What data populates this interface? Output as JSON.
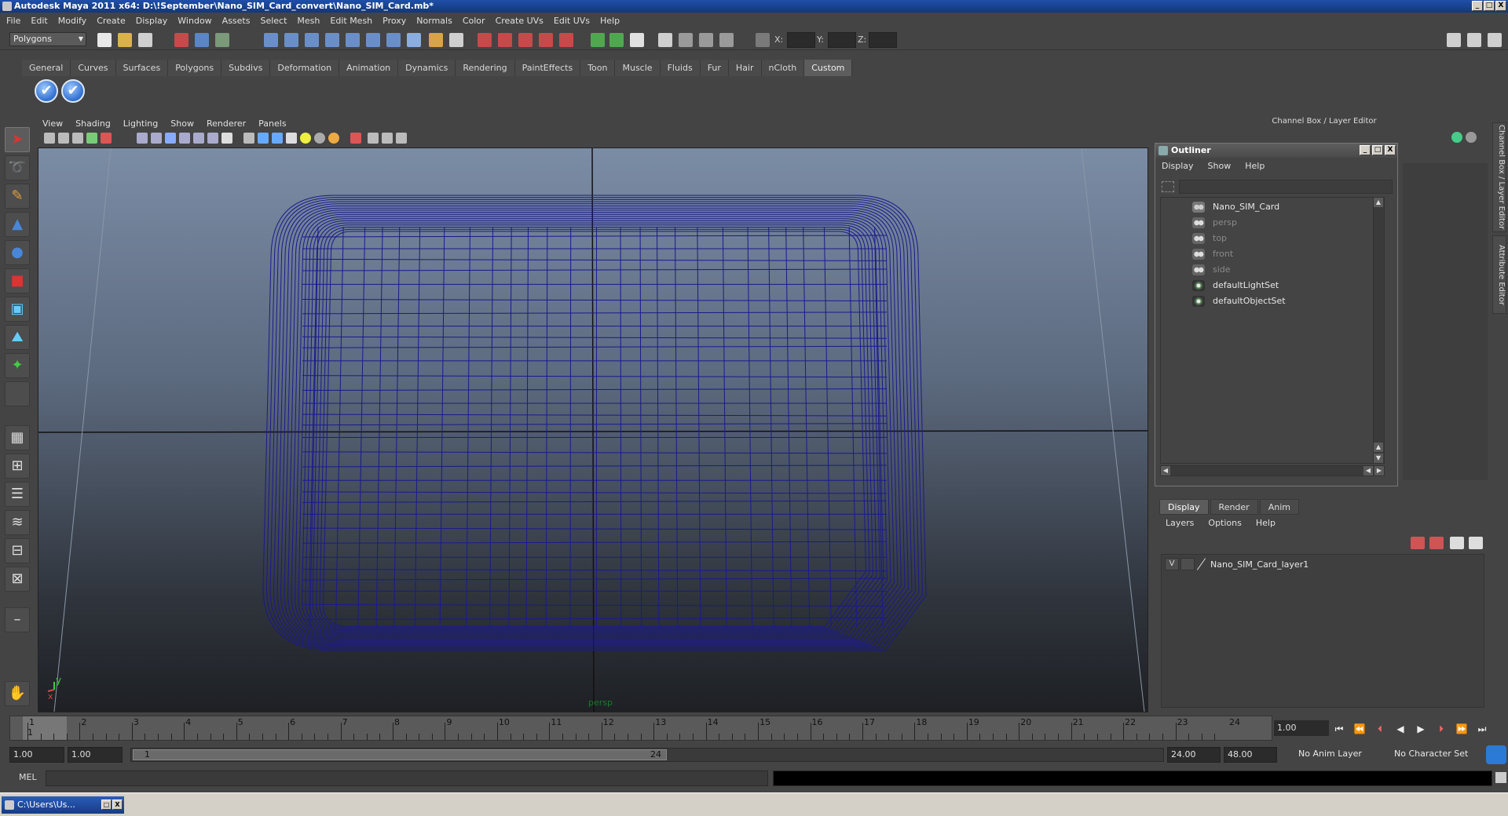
{
  "window": {
    "title": "Autodesk Maya 2011 x64: D:\\!September\\Nano_SIM_Card_convert\\Nano_SIM_Card.mb*",
    "controls": [
      "_",
      "□",
      "X"
    ]
  },
  "menubar": [
    "File",
    "Edit",
    "Modify",
    "Create",
    "Display",
    "Window",
    "Assets",
    "Select",
    "Mesh",
    "Edit Mesh",
    "Proxy",
    "Normals",
    "Color",
    "Create UVs",
    "Edit UVs",
    "Help"
  ],
  "statusline": {
    "mode": "Polygons",
    "x_label": "X:",
    "y_label": "Y:",
    "z_label": "Z:"
  },
  "shelf": {
    "tabs": [
      "General",
      "Curves",
      "Surfaces",
      "Polygons",
      "Subdivs",
      "Deformation",
      "Animation",
      "Dynamics",
      "Rendering",
      "PaintEffects",
      "Toon",
      "Muscle",
      "Fluids",
      "Fur",
      "Hair",
      "nCloth",
      "Custom"
    ],
    "active_tab": "Custom",
    "buttons": [
      "✔",
      "✔"
    ]
  },
  "viewport": {
    "menu": [
      "View",
      "Shading",
      "Lighting",
      "Show",
      "Renderer",
      "Panels"
    ],
    "camera_label": "persp",
    "axis_y": "y",
    "axis_x": "x",
    "wire_color": "#1a1a8c"
  },
  "channel_box": {
    "title": "Channel Box / Layer Editor",
    "vtabs": [
      "Channel Box / Layer Editor",
      "Attribute Editor"
    ]
  },
  "outliner": {
    "title": "Outliner",
    "menu": [
      "Display",
      "Show",
      "Help"
    ],
    "items": [
      {
        "label": "Nano_SIM_Card",
        "icon": "mesh-icon",
        "dim": false
      },
      {
        "label": "persp",
        "icon": "camera-icon",
        "dim": true
      },
      {
        "label": "top",
        "icon": "camera-icon",
        "dim": true
      },
      {
        "label": "front",
        "icon": "camera-icon",
        "dim": true
      },
      {
        "label": "side",
        "icon": "camera-icon",
        "dim": true
      },
      {
        "label": "defaultLightSet",
        "icon": "set-icon",
        "dim": false
      },
      {
        "label": "defaultObjectSet",
        "icon": "set-icon",
        "dim": false
      }
    ]
  },
  "layer_editor": {
    "tabs": [
      "Display",
      "Render",
      "Anim"
    ],
    "active_tab": "Display",
    "menu": [
      "Layers",
      "Options",
      "Help"
    ],
    "layers": [
      {
        "visible": "V",
        "name": "Nano_SIM_Card_layer1"
      }
    ]
  },
  "timeline": {
    "ticks": [
      "1",
      "2",
      "3",
      "4",
      "5",
      "6",
      "7",
      "8",
      "9",
      "10",
      "11",
      "12",
      "13",
      "14",
      "15",
      "16",
      "17",
      "18",
      "19",
      "20",
      "21",
      "22",
      "23",
      "24"
    ],
    "current_frame_marker": "1",
    "current_frame": "1.00"
  },
  "range": {
    "start": "1.00",
    "playback_start": "1.00",
    "range_start_label": "1",
    "range_end_label": "24",
    "playback_end": "24.00",
    "end": "48.00",
    "anim_layer": "No Anim Layer",
    "character_set": "No Character Set"
  },
  "command_line": {
    "label": "MEL"
  },
  "taskbar": {
    "item": "C:\\Users\\Us..."
  }
}
